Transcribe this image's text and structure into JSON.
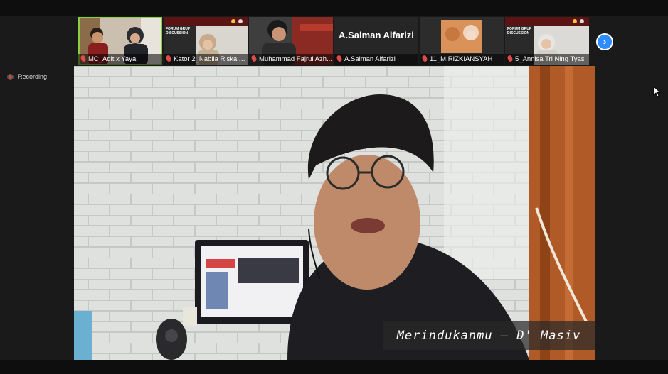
{
  "meeting": {
    "recording_label": "Recording"
  },
  "participants": [
    {
      "name": "MC_Adit x Yaya"
    },
    {
      "name": "Kator 2_Nabila Riska A..."
    },
    {
      "name": "Muhammad Fajrul Azh..."
    },
    {
      "name": "A.Salman Alfarizi",
      "display_name": "A.Salman Alfarizi"
    },
    {
      "name": "11_M.RIZKIANSYAH"
    },
    {
      "name": "5_Annisa Tri Ning Tyas"
    }
  ],
  "video": {
    "caption": "Merindukanmu – D' Masiv"
  },
  "icons": {
    "next_page": "chevron-right-icon",
    "mic_muted": "mic-muted-icon",
    "recording": "recording-dot-icon",
    "cursor": "mouse-cursor-icon"
  },
  "colors": {
    "active_speaker_border": "#8ccf3e",
    "next_button": "#2d8cff",
    "recording_dot": "#e03c3c",
    "mic_muted": "#e24a4a"
  }
}
